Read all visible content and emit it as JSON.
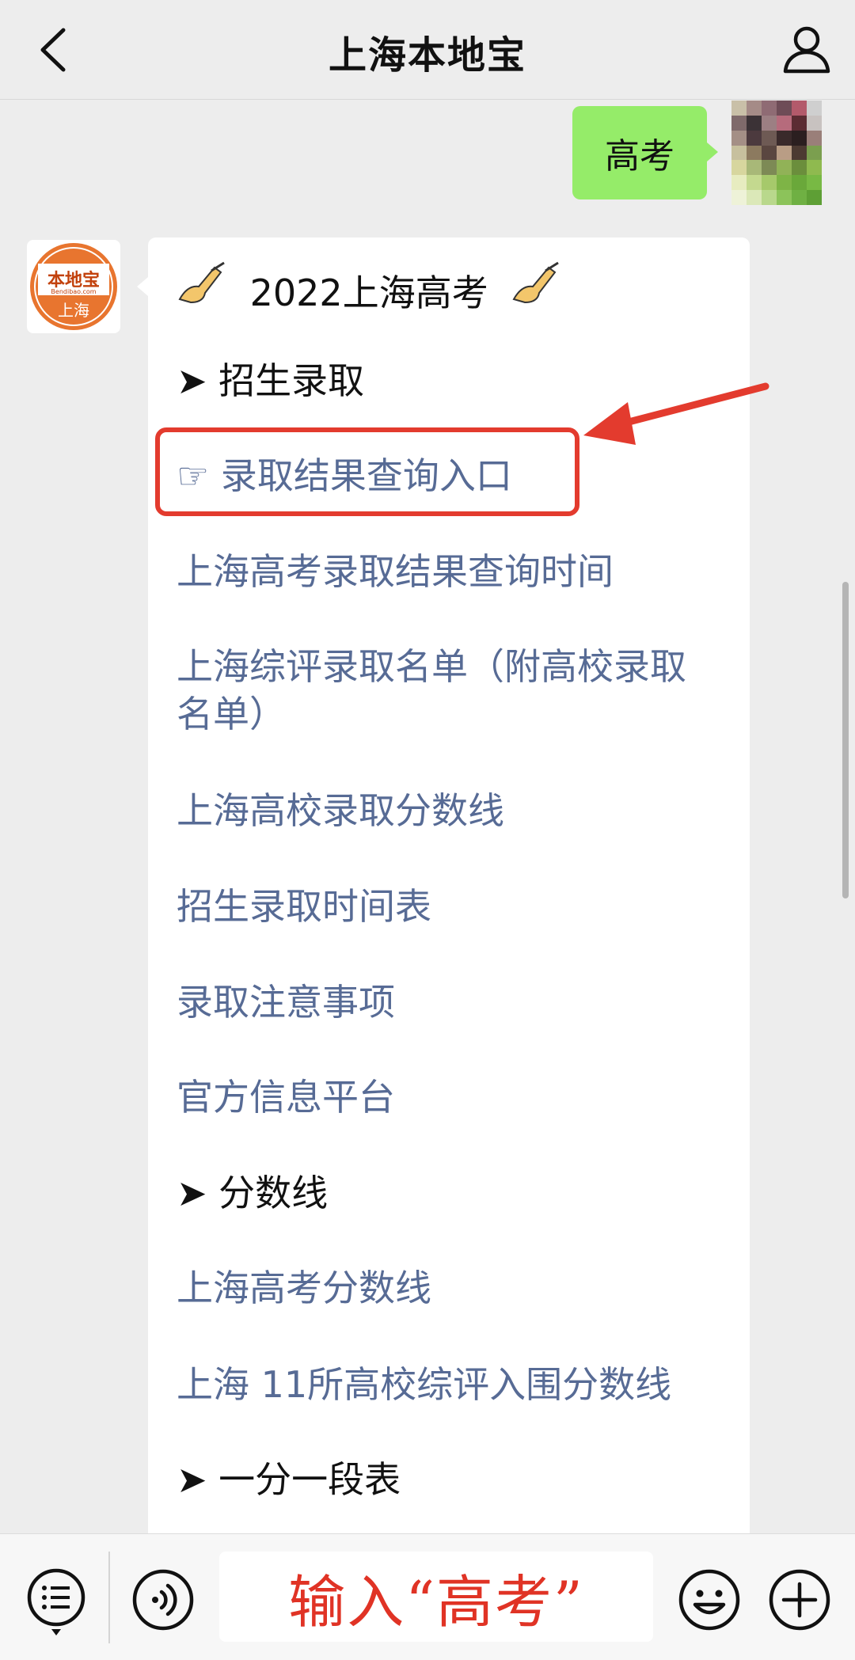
{
  "header": {
    "title": "上海本地宝"
  },
  "outgoing_message": {
    "text": "高考"
  },
  "bot_avatar": {
    "logo_text": "本地宝",
    "logo_sub": "Bendibao.com",
    "city": "上海"
  },
  "card": {
    "title": "2022上海高考",
    "sections": [
      {
        "label": "➤ 招生录取"
      },
      {
        "label": "☞ 录取结果查询入口"
      },
      {
        "label": "上海高考录取结果查询时间"
      },
      {
        "label": "上海综评录取名单（附高校录取名单）"
      },
      {
        "label": "上海高校录取分数线"
      },
      {
        "label": "招生录取时间表"
      },
      {
        "label": "录取注意事项"
      },
      {
        "label": "官方信息平台"
      },
      {
        "label": "➤ 分数线"
      },
      {
        "label": "上海高考分数线"
      },
      {
        "label": "上海 11所高校综评入围分数线"
      },
      {
        "label": "➤ 一分一段表"
      }
    ]
  },
  "input_bar": {
    "value": "输入“高考”"
  },
  "colors": {
    "accent_green": "#95ec69",
    "link_blue": "#576b95",
    "highlight_red": "#e33b2e",
    "logo_orange": "#e8752f"
  },
  "icons": [
    "back-arrow-icon",
    "profile-icon",
    "menu-list-icon",
    "voice-icon",
    "emoji-icon",
    "plus-icon",
    "pointing-hand-icon",
    "writing-hand-icon",
    "red-arrow-icon"
  ]
}
